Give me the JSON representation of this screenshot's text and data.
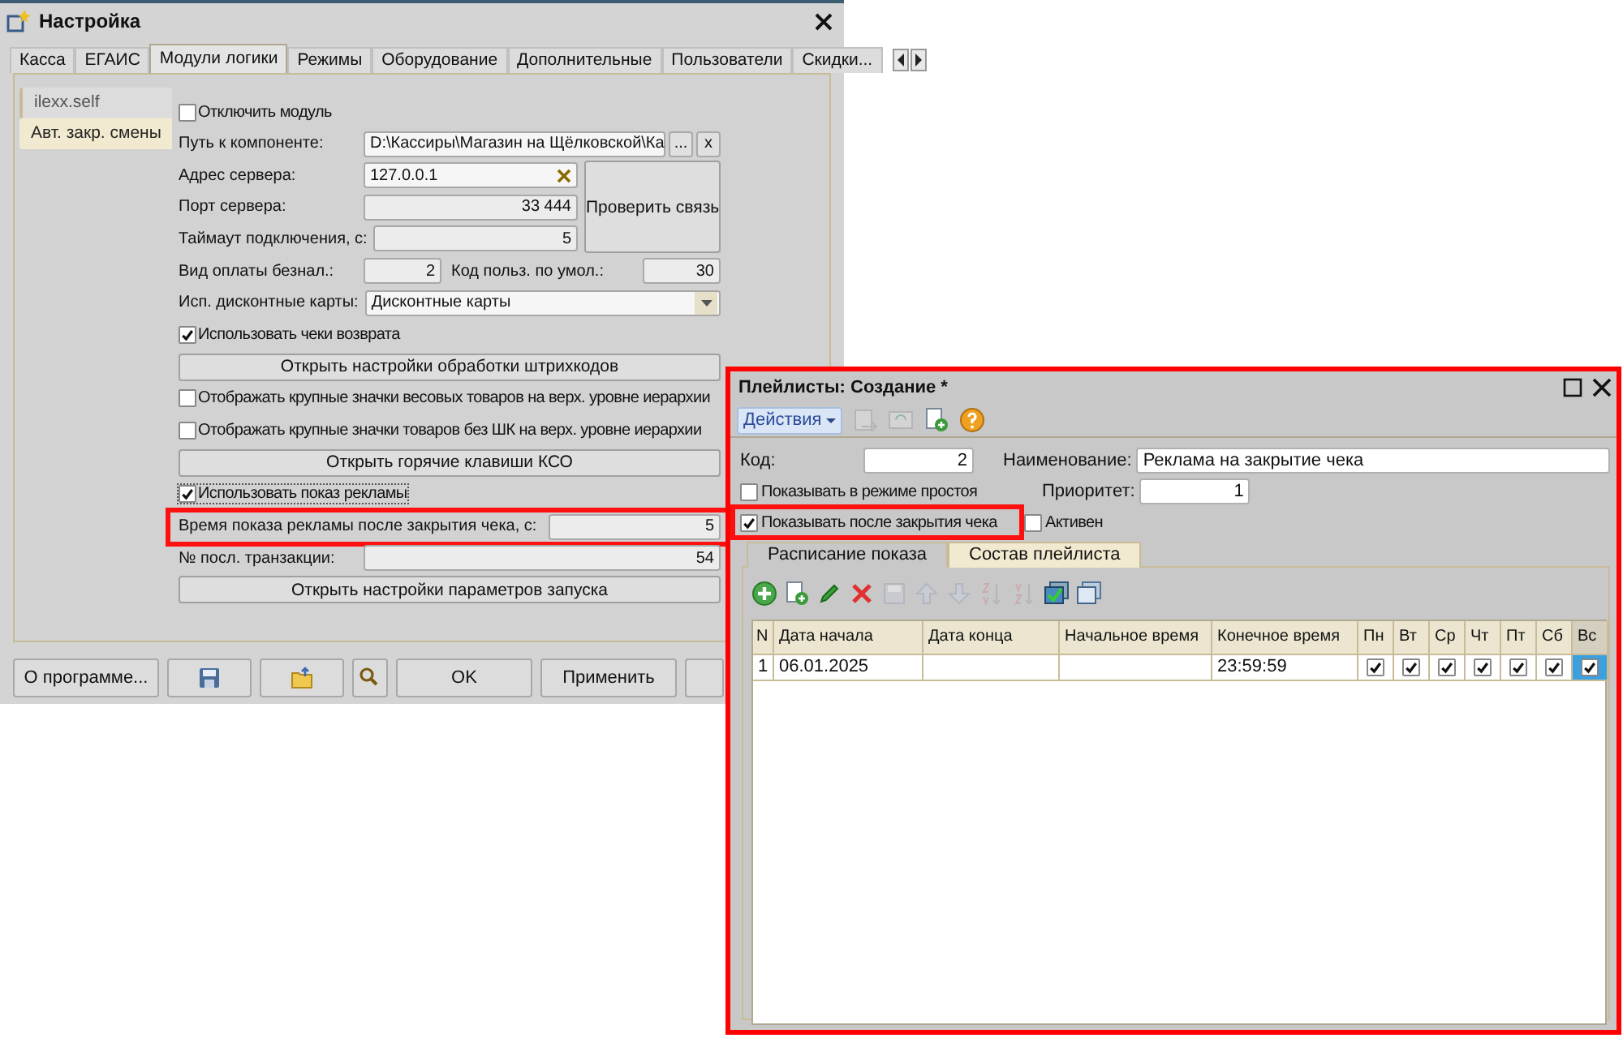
{
  "settings_window": {
    "title": "Настройка",
    "tabs": [
      {
        "label": "Касса",
        "selected": false
      },
      {
        "label": "ЕГАИС",
        "selected": false
      },
      {
        "label": "Модули логики",
        "selected": true
      },
      {
        "label": "Режимы",
        "selected": false
      },
      {
        "label": "Оборудование",
        "selected": false
      },
      {
        "label": "Дополнительные",
        "selected": false
      },
      {
        "label": "Пользователи",
        "selected": false
      },
      {
        "label": "Скидки...",
        "selected": false
      }
    ],
    "modules": [
      {
        "label": "ilexx.self",
        "selected": true
      },
      {
        "label": "Авт. закр. смены",
        "selected": false
      }
    ],
    "rows": [
      {
        "kind": "checkbox",
        "label": "Отключить модуль",
        "checked": false
      },
      {
        "kind": "path",
        "label": "Путь к компоненте:",
        "value": "D:\\Кассиры\\Магазин на Щёлковской\\Ка",
        "buttons": [
          "...",
          "x"
        ]
      },
      {
        "kind": "group",
        "button": "Проверить связь",
        "fields": [
          {
            "label": "Адрес сервера:",
            "value": "127.0.0.1",
            "clearable": true
          },
          {
            "label": "Порт сервера:",
            "value": "33 444",
            "clearable": false
          },
          {
            "label": "Таймаут подключения, с:",
            "value": "5",
            "clearable": false
          }
        ]
      },
      {
        "kind": "pair",
        "fields": [
          {
            "label": "Вид оплаты безнал.:",
            "value": "2"
          },
          {
            "label": "Код польз. по умол.:",
            "value": "30"
          }
        ]
      },
      {
        "kind": "dropdown",
        "label": "Исп. дисконтные карты:",
        "value": "Дисконтные карты"
      },
      {
        "kind": "checkbox",
        "label": "Использовать чеки возврата",
        "checked": true
      },
      {
        "kind": "button",
        "label": "Открыть настройки обработки штрихкодов"
      },
      {
        "kind": "checkbox",
        "label": "Отображать крупные значки весовых товаров на верх. уровне иерархии",
        "checked": false
      },
      {
        "kind": "checkbox",
        "label": "Отображать крупные значки товаров без ШК на верх. уровне иерархии",
        "checked": false
      },
      {
        "kind": "button",
        "label": "Открыть горячие клавиши КСО"
      },
      {
        "kind": "checkbox",
        "label": "Использовать показ рекламы",
        "checked": true,
        "focused": true
      },
      {
        "kind": "field",
        "label": "Время показа рекламы после закрытия чека, с:",
        "value": "5",
        "highlighted": true
      },
      {
        "kind": "field",
        "label": "№ посл. транзакции:",
        "value": "54",
        "highlighted": false
      },
      {
        "kind": "button",
        "label": "Открыть настройки параметров запуска"
      }
    ],
    "footer_buttons": [
      {
        "kind": "text",
        "label": "О программе..."
      },
      {
        "kind": "save"
      },
      {
        "kind": "open"
      },
      {
        "kind": "search"
      },
      {
        "kind": "text",
        "label": "OK"
      },
      {
        "kind": "text",
        "label": "Применить"
      }
    ]
  },
  "playlist_window": {
    "title": "Плейлисты: Создание *",
    "actions": "Действия",
    "code": {
      "label": "Код:",
      "value": "2"
    },
    "name": {
      "label": "Наименование:",
      "value": "Реклама на закрытие чека"
    },
    "idle": {
      "label": "Показывать в режиме простоя",
      "checked": false,
      "highlighted": false
    },
    "priority": {
      "label": "Приоритет:",
      "value": "1"
    },
    "after_close": {
      "label": "Показывать после закрытия чека",
      "checked": true,
      "highlighted": true
    },
    "active": {
      "label": "Активен",
      "checked": false,
      "highlighted": false
    },
    "tabs": [
      {
        "label": "Расписание показа",
        "selected": true
      },
      {
        "label": "Состав плейлиста",
        "selected": false
      }
    ],
    "table": {
      "columns": [
        {
          "label": "N",
          "selected": false
        },
        {
          "label": "Дата начала",
          "selected": false
        },
        {
          "label": "Дата конца",
          "selected": false
        },
        {
          "label": "Начальное время",
          "selected": false
        },
        {
          "label": "Конечное время",
          "selected": false
        },
        {
          "label": "Пн",
          "selected": false
        },
        {
          "label": "Вт",
          "selected": false
        },
        {
          "label": "Ср",
          "selected": false
        },
        {
          "label": "Чт",
          "selected": false
        },
        {
          "label": "Пт",
          "selected": false
        },
        {
          "label": "Сб",
          "selected": false
        },
        {
          "label": "Вс",
          "selected": true
        }
      ],
      "rows": [
        {
          "cells": [
            "1",
            "06.01.2025",
            "",
            "",
            "23:59:59"
          ],
          "days": [
            {
              "checked": true,
              "selected": false
            },
            {
              "checked": true,
              "selected": false
            },
            {
              "checked": true,
              "selected": false
            },
            {
              "checked": true,
              "selected": false
            },
            {
              "checked": true,
              "selected": false
            },
            {
              "checked": true,
              "selected": false
            },
            {
              "checked": true,
              "selected": true
            }
          ]
        }
      ]
    }
  }
}
